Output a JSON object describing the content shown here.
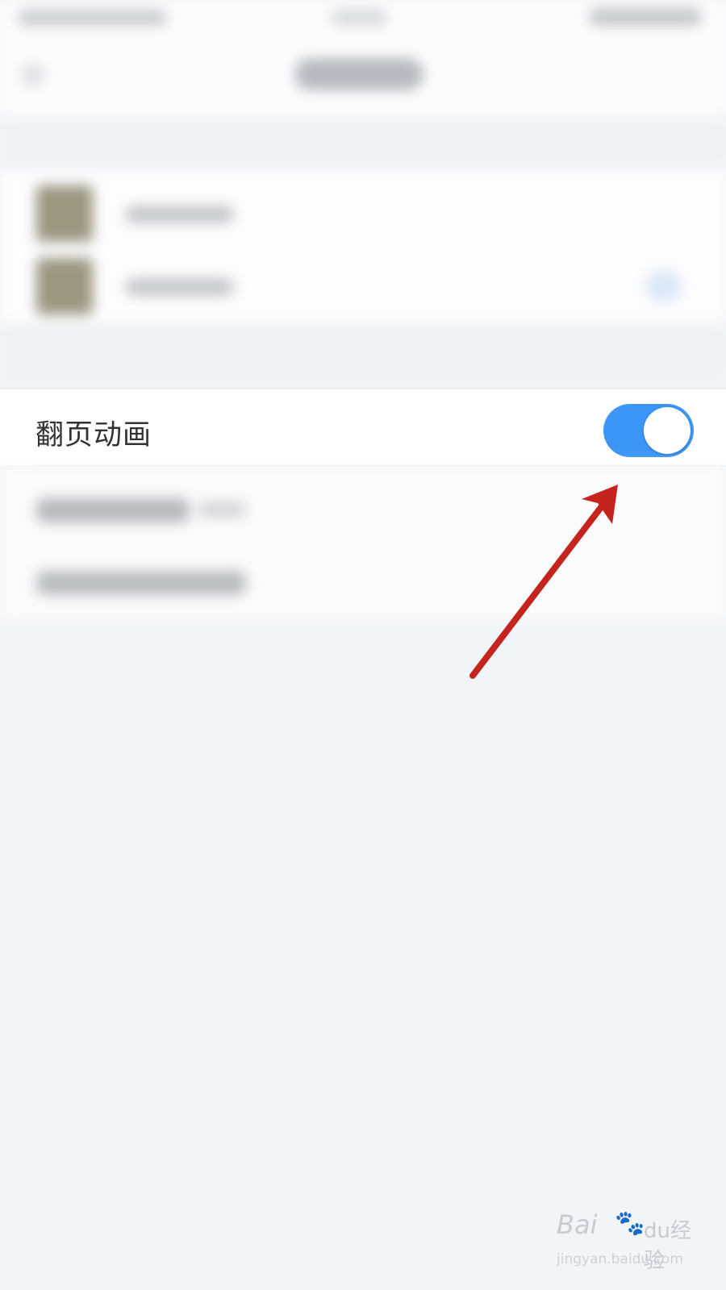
{
  "settings": {
    "page_flip_animation": {
      "label": "翻页动画",
      "enabled": true
    }
  },
  "colors": {
    "toggle_on": "#3c96f7",
    "toggle_knob": "#ffffff",
    "arrow": "#c5241e",
    "background": "#f2f5f8"
  },
  "icons": {
    "annotation": "arrow-icon",
    "watermark_paw": "paw-icon"
  },
  "watermark": {
    "brand": "Bai",
    "suffix": "du",
    "cn": "经验",
    "url": "jingyan.baidu.com"
  }
}
